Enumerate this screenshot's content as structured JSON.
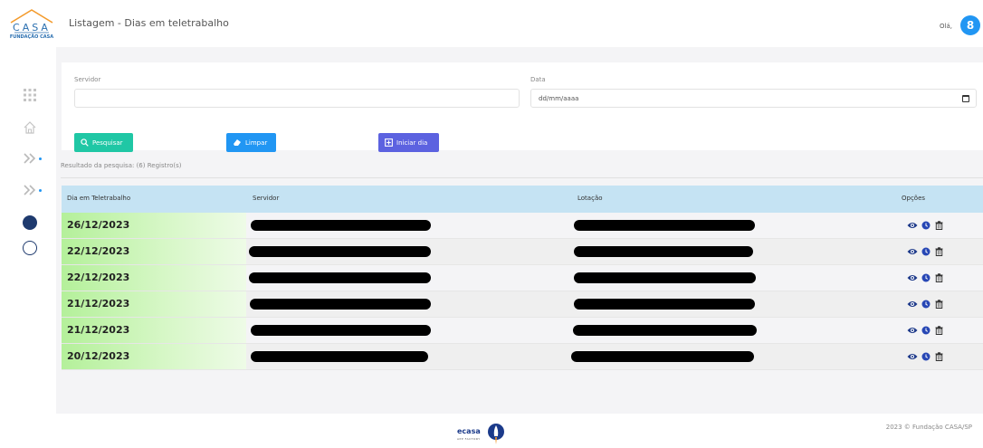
{
  "header": {
    "logo_word": "CASA",
    "logo_caption": "FUNDAÇÃO CASA",
    "title": "Listagem - Dias em teletrabalho",
    "greeting": "Olá,",
    "avatar_initial": "8"
  },
  "filters": {
    "servidor_label": "Servidor",
    "servidor_value": "",
    "data_label": "Data",
    "data_placeholder": "dd/mm/aaaa"
  },
  "buttons": {
    "search": "Pesquisar",
    "clear": "Limpar",
    "start_day": "Iniciar dia"
  },
  "result_text": "Resultado da pesquisa: (6) Registro(s)",
  "table": {
    "headers": {
      "date": "Dia em Teletrabalho",
      "server": "Servidor",
      "location": "Lotação",
      "options": "Opções"
    },
    "rows": [
      {
        "date": "26/12/2023"
      },
      {
        "date": "22/12/2023"
      },
      {
        "date": "22/12/2023"
      },
      {
        "date": "21/12/2023"
      },
      {
        "date": "21/12/2023"
      },
      {
        "date": "20/12/2023"
      }
    ]
  },
  "footer": {
    "brand": "ecasa",
    "brand_sub": "APP FACTORY",
    "copyright": "2023 © Fundação CASA/SP"
  },
  "colors": {
    "accent_blue": "#2196f3",
    "teal_button": "#20c7a5",
    "purple_button": "#5c62e0",
    "table_header": "#c5e3f3",
    "date_highlight": "#b4f09a",
    "navy": "#1e3a6e"
  }
}
